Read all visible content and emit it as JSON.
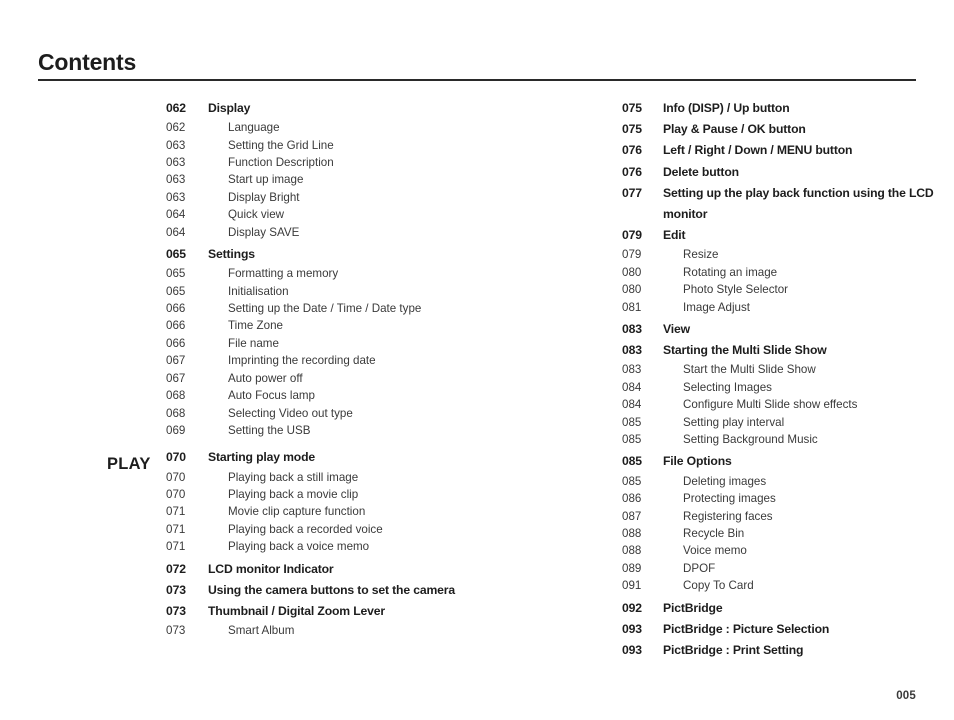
{
  "header": {
    "title": "Contents"
  },
  "section_tag": "PLAY",
  "folio": "005",
  "columns": {
    "left": [
      {
        "num": "062",
        "label": "Display",
        "bold": true,
        "gap": "none"
      },
      {
        "num": "062",
        "label": "Language",
        "bold": false,
        "gap": "none"
      },
      {
        "num": "063",
        "label": "Setting the Grid Line",
        "bold": false,
        "gap": "none"
      },
      {
        "num": "063",
        "label": "Function Description",
        "bold": false,
        "gap": "none"
      },
      {
        "num": "063",
        "label": "Start up image",
        "bold": false,
        "gap": "none"
      },
      {
        "num": "063",
        "label": "Display Bright",
        "bold": false,
        "gap": "none"
      },
      {
        "num": "064",
        "label": "Quick view",
        "bold": false,
        "gap": "none"
      },
      {
        "num": "064",
        "label": "Display SAVE",
        "bold": false,
        "gap": "none"
      },
      {
        "num": "065",
        "label": "Settings",
        "bold": true,
        "gap": "sm"
      },
      {
        "num": "065",
        "label": "Formatting a memory",
        "bold": false,
        "gap": "none"
      },
      {
        "num": "065",
        "label": "Initialisation",
        "bold": false,
        "gap": "none"
      },
      {
        "num": "066",
        "label": "Setting up the Date / Time / Date type",
        "bold": false,
        "gap": "none"
      },
      {
        "num": "066",
        "label": "Time Zone",
        "bold": false,
        "gap": "none"
      },
      {
        "num": "066",
        "label": "File name",
        "bold": false,
        "gap": "none"
      },
      {
        "num": "067",
        "label": "Imprinting the recording date",
        "bold": false,
        "gap": "none"
      },
      {
        "num": "067",
        "label": "Auto power off",
        "bold": false,
        "gap": "none"
      },
      {
        "num": "068",
        "label": "Auto Focus lamp",
        "bold": false,
        "gap": "none"
      },
      {
        "num": "068",
        "label": "Selecting Video out type",
        "bold": false,
        "gap": "none"
      },
      {
        "num": "069",
        "label": "Setting the USB",
        "bold": false,
        "gap": "none"
      },
      {
        "num": "070",
        "label": "Starting play mode",
        "bold": true,
        "gap": "lg"
      },
      {
        "num": "070",
        "label": "Playing back a still image",
        "bold": false,
        "gap": "none"
      },
      {
        "num": "070",
        "label": "Playing back a movie clip",
        "bold": false,
        "gap": "none"
      },
      {
        "num": "071",
        "label": "Movie clip capture function",
        "bold": false,
        "gap": "none"
      },
      {
        "num": "071",
        "label": "Playing back a recorded voice",
        "bold": false,
        "gap": "none"
      },
      {
        "num": "071",
        "label": "Playing back a voice memo",
        "bold": false,
        "gap": "none"
      },
      {
        "num": "072",
        "label": "LCD monitor Indicator",
        "bold": true,
        "gap": "sm"
      },
      {
        "num": "073",
        "label": "Using the camera buttons to set the camera",
        "bold": true,
        "gap": "none"
      },
      {
        "num": "073",
        "label": "Thumbnail / Digital Zoom  Lever",
        "bold": true,
        "gap": "none"
      },
      {
        "num": "073",
        "label": "Smart Album",
        "bold": false,
        "gap": "none"
      }
    ],
    "right": [
      {
        "num": "075",
        "label": "Info (DISP) / Up button",
        "bold": true,
        "gap": "none"
      },
      {
        "num": "075",
        "label": "Play & Pause / OK button",
        "bold": true,
        "gap": "none"
      },
      {
        "num": "076",
        "label": "Left / Right / Down / MENU button",
        "bold": true,
        "gap": "none"
      },
      {
        "num": "076",
        "label": "Delete button",
        "bold": true,
        "gap": "none"
      },
      {
        "num": "077",
        "label": "Setting up the play back function using the LCD monitor",
        "bold": true,
        "gap": "none"
      },
      {
        "num": "079",
        "label": "Edit",
        "bold": true,
        "gap": "none"
      },
      {
        "num": "079",
        "label": "Resize",
        "bold": false,
        "gap": "none"
      },
      {
        "num": "080",
        "label": "Rotating an image",
        "bold": false,
        "gap": "none"
      },
      {
        "num": "080",
        "label": "Photo Style Selector",
        "bold": false,
        "gap": "none"
      },
      {
        "num": "081",
        "label": "Image Adjust",
        "bold": false,
        "gap": "none"
      },
      {
        "num": "083",
        "label": "View",
        "bold": true,
        "gap": "sm"
      },
      {
        "num": "083",
        "label": "Starting the Multi Slide Show",
        "bold": true,
        "gap": "none"
      },
      {
        "num": "083",
        "label": "Start the Multi Slide Show",
        "bold": false,
        "gap": "none"
      },
      {
        "num": "084",
        "label": "Selecting Images",
        "bold": false,
        "gap": "none"
      },
      {
        "num": "084",
        "label": "Configure Multi Slide show effects",
        "bold": false,
        "gap": "none"
      },
      {
        "num": "085",
        "label": "Setting play interval",
        "bold": false,
        "gap": "none"
      },
      {
        "num": "085",
        "label": "Setting Background Music",
        "bold": false,
        "gap": "none"
      },
      {
        "num": "085",
        "label": "File Options",
        "bold": true,
        "gap": "sm"
      },
      {
        "num": "085",
        "label": "Deleting images",
        "bold": false,
        "gap": "none"
      },
      {
        "num": "086",
        "label": "Protecting images",
        "bold": false,
        "gap": "none"
      },
      {
        "num": "087",
        "label": "Registering faces",
        "bold": false,
        "gap": "none"
      },
      {
        "num": "088",
        "label": "Recycle Bin",
        "bold": false,
        "gap": "none"
      },
      {
        "num": "088",
        "label": "Voice memo",
        "bold": false,
        "gap": "none"
      },
      {
        "num": "089",
        "label": "DPOF",
        "bold": false,
        "gap": "none"
      },
      {
        "num": "091",
        "label": "Copy To Card",
        "bold": false,
        "gap": "none"
      },
      {
        "num": "092",
        "label": "PictBridge",
        "bold": true,
        "gap": "sm"
      },
      {
        "num": "093",
        "label": "PictBridge : Picture Selection",
        "bold": true,
        "gap": "none"
      },
      {
        "num": "093",
        "label": "PictBridge : Print Setting",
        "bold": true,
        "gap": "none"
      }
    ]
  }
}
